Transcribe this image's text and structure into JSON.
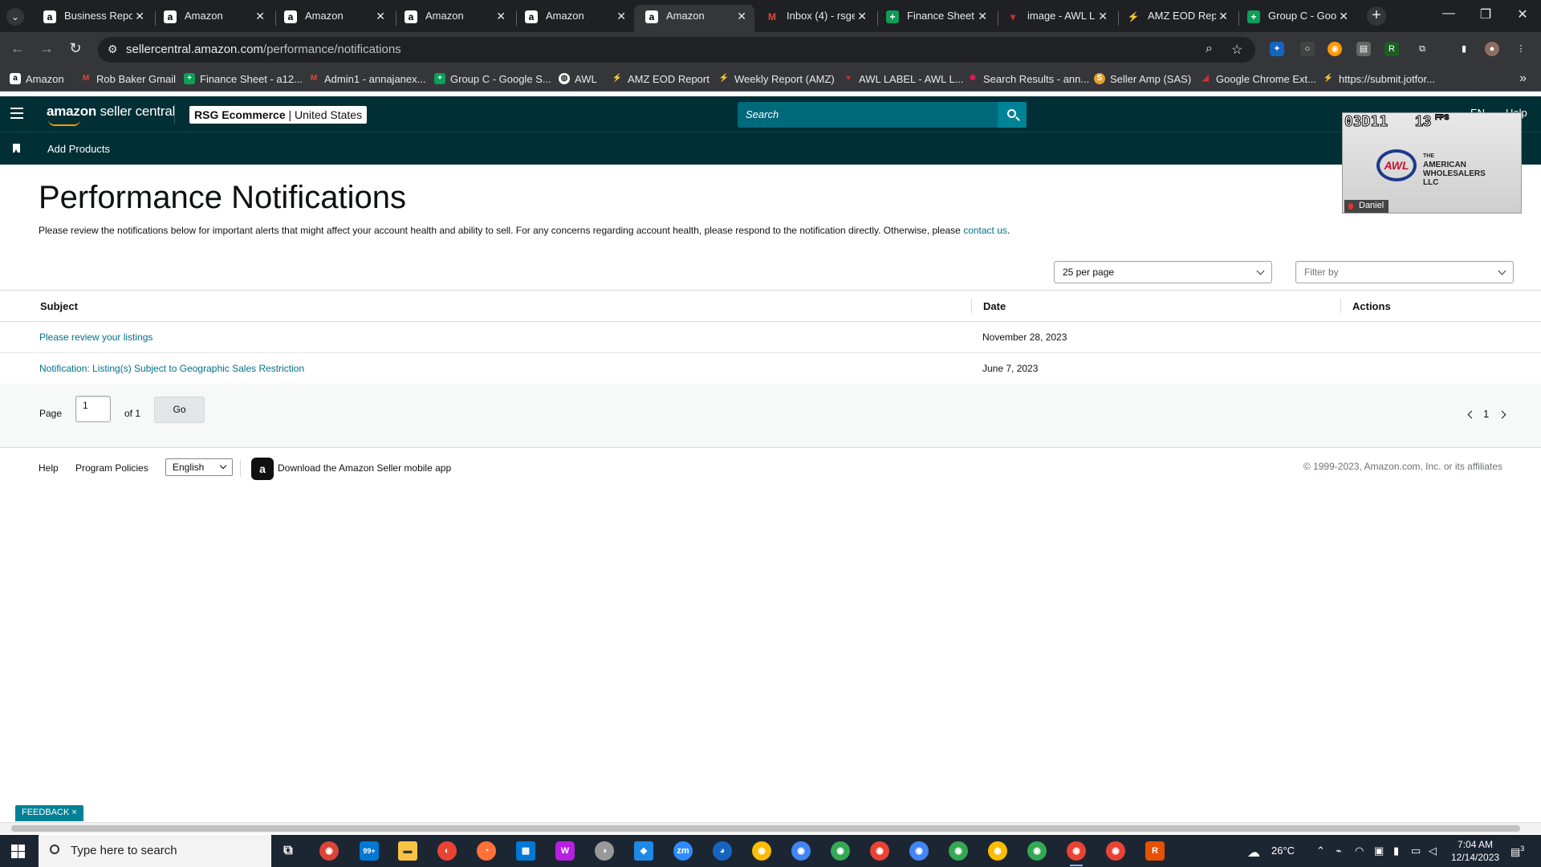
{
  "browser": {
    "tabs": [
      {
        "title": "Business Report",
        "icon": "amazon-favicon",
        "active": false
      },
      {
        "title": "Amazon",
        "icon": "amazon-favicon",
        "active": false
      },
      {
        "title": "Amazon",
        "icon": "amazon-favicon",
        "active": false
      },
      {
        "title": "Amazon",
        "icon": "amazon-favicon",
        "active": false
      },
      {
        "title": "Amazon",
        "icon": "amazon-favicon",
        "active": false
      },
      {
        "title": "Amazon",
        "icon": "amazon-favicon",
        "active": true
      },
      {
        "title": "Inbox (4) - rsge",
        "icon": "gmail-favicon",
        "active": false
      },
      {
        "title": "Finance Sheet",
        "icon": "sheets-favicon",
        "active": false
      },
      {
        "title": "image - AWL L",
        "icon": "awl-favicon",
        "active": false
      },
      {
        "title": "AMZ EOD Rep",
        "icon": "report-favicon",
        "active": false
      },
      {
        "title": "Group C - Goo",
        "icon": "sheets-favicon",
        "active": false
      }
    ],
    "url_host": "sellercentral.amazon.com",
    "url_path": "/performance/notifications",
    "bookmarks": [
      {
        "label": "Amazon",
        "icon": "amazon-favicon"
      },
      {
        "label": "Rob Baker Gmail",
        "icon": "gmail-favicon"
      },
      {
        "label": "Finance Sheet - a12...",
        "icon": "sheets-favicon"
      },
      {
        "label": "Admin1 - annajanex...",
        "icon": "gmail-favicon"
      },
      {
        "label": "Group C - Google S...",
        "icon": "sheets-favicon"
      },
      {
        "label": "AWL",
        "icon": "globe-favicon"
      },
      {
        "label": "AMZ EOD Report",
        "icon": "report-favicon"
      },
      {
        "label": "Weekly Report (AMZ)",
        "icon": "report-favicon"
      },
      {
        "label": "AWL LABEL - AWL L...",
        "icon": "awl-favicon"
      },
      {
        "label": "Search Results - ann...",
        "icon": "slack-favicon"
      },
      {
        "label": "Seller Amp (SAS)",
        "icon": "selleramp-favicon"
      },
      {
        "label": "Google Chrome Ext...",
        "icon": "chrome-favicon"
      },
      {
        "label": "https://submit.jotfor...",
        "icon": "jotform-favicon"
      }
    ]
  },
  "header": {
    "logo_brand": "amazon",
    "logo_product": " seller central",
    "account_name": "RSG Ecommerce",
    "account_region": "United States",
    "search_placeholder": "Search",
    "right_items": [
      "EN",
      "Help"
    ]
  },
  "subnav": {
    "add_products": "Add Products"
  },
  "page": {
    "title": "Performance Notifications",
    "intro": "Please review the notifications below for important alerts that might affect your account health and ability to sell. For any concerns regarding account health, please respond to the notification directly. Otherwise, please ",
    "intro_link": "contact us",
    "intro_end": ".",
    "per_page": "25 per page",
    "filter_placeholder": "Filter by"
  },
  "table": {
    "columns": [
      "Subject",
      "Date",
      "Actions"
    ],
    "rows": [
      {
        "subject": "Please review your listings",
        "date": "November 28, 2023"
      },
      {
        "subject": "Notification: Listing(s) Subject to Geographic Sales Restriction",
        "date": "June 7, 2023"
      }
    ]
  },
  "pagination": {
    "page_label": "Page",
    "page_value": "1",
    "of_label": "of 1",
    "go_label": "Go",
    "current_page": "1"
  },
  "footer": {
    "help": "Help",
    "program_policies": "Program Policies",
    "language": "English",
    "app_download": "Download the Amazon Seller mobile app",
    "copyright": "© 1999-2023, Amazon.com, Inc. or its affiliates"
  },
  "overlay": {
    "counter": "03D11",
    "fps": "13",
    "fps_unit": "FPS",
    "company_line1": "THE",
    "company_line2": "AMERICAN",
    "company_line3": "WHOLESALERS",
    "company_line4": "LLC",
    "logo_text": "AWL",
    "user": "Daniel"
  },
  "feedback_label": "FEEDBACK ×",
  "taskbar": {
    "search_placeholder": "Type here to search",
    "mail_badge": "99+",
    "temperature": "26°C",
    "time": "7:04 AM",
    "date": "12/14/2023",
    "notification_count": "3"
  },
  "colors": {
    "header_bg": "#002f36",
    "link": "#007185",
    "search_bg": "#00697a",
    "feedback_bg": "#008296"
  }
}
